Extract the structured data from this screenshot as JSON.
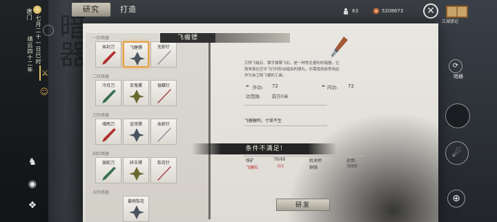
{
  "left_rail": {
    "location": "唐门",
    "time_of_day": "矣章",
    "date": "七月二十一日巳时",
    "place": "靖远四十二年"
  },
  "tabs": [
    "研究",
    "打造"
  ],
  "top_right": {
    "currency1_value": "63",
    "currency2_value": "5208673",
    "journal_label": "江湖游记",
    "anqi_label": "暗器"
  },
  "weapon_list": {
    "tiers": [
      {
        "label": "一阶暗器",
        "items": [
          "血封刀",
          "飞蝗镖",
          "无影针"
        ]
      },
      {
        "label": "二阶暗器",
        "items": [
          "冷月刀",
          "百鬼螺",
          "银蝶针"
        ]
      },
      {
        "label": "三阶暗器",
        "items": [
          "魂雨刀",
          "金钱镖",
          "血影针"
        ]
      },
      {
        "label": "四阶暗器",
        "items": [
          "银蛇刀",
          "碎玉镖",
          "梨花针"
        ]
      },
      {
        "label": "五阶暗器",
        "items": [
          "",
          "暴雨梨花",
          ""
        ]
      }
    ],
    "selected": "飞蝗镖"
  },
  "detail": {
    "name": "飞蝗镖",
    "description": "又称飞蝗石、镖手弹镖飞石，是一种常见便利的暗器，它简单易在空中飞行时形似蝗虫的弹丸，亦需增用前常用此作为自卫和飞镖的工具。",
    "outer_label": "外功:",
    "outer_value": "72",
    "inner_label": "内功:",
    "inner_value": "72",
    "range_label": "功范围:",
    "range_value": "前方6米",
    "flavor": "飞蝗蝗鸣，寸草不生"
  },
  "materials": [
    {
      "name": "铁矿",
      "count": "78/40",
      "ok": true
    },
    {
      "name": "飞蝗石",
      "count": "0/1",
      "ok": false
    }
  ],
  "materials_right": [
    {
      "name": "机关师",
      "value": "达到"
    },
    {
      "name": "铜钱",
      "value": "3000"
    }
  ],
  "toast": "条件不满足!",
  "research_button": "研发",
  "colors": {
    "accent": "#e8a040",
    "warn": "#b33333",
    "panel": "#e9e7e2"
  }
}
